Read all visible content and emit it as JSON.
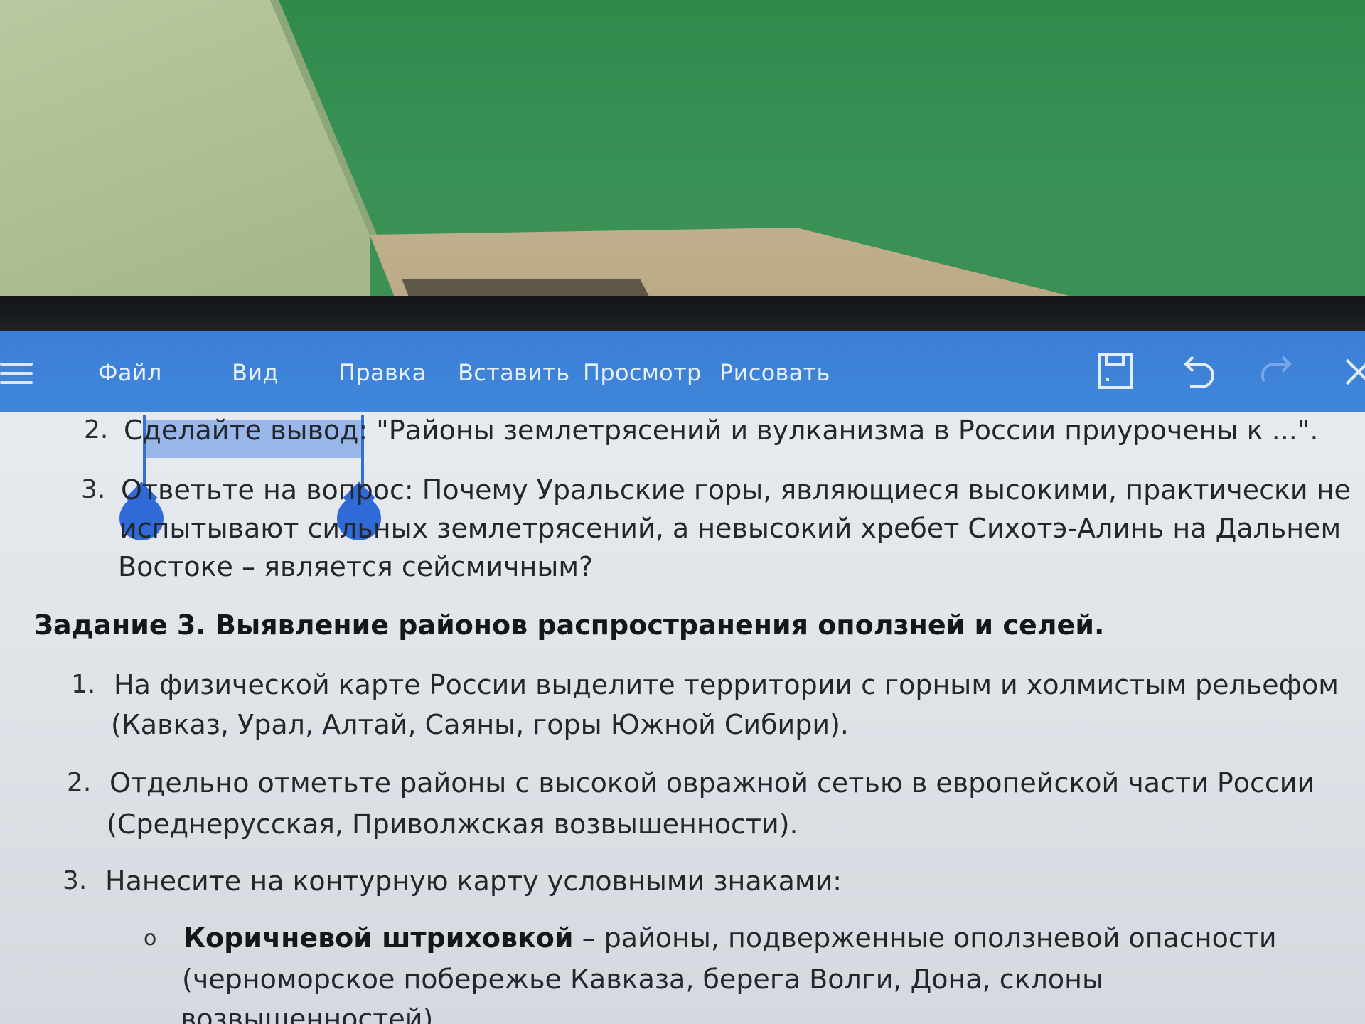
{
  "app": {
    "menu": [
      "Файл",
      "Вид",
      "Правка",
      "Вставить",
      "Просмотр",
      "Рисовать"
    ]
  },
  "toolbar_icons": [
    "menu-icon",
    "save-icon",
    "undo-icon",
    "redo-icon",
    "close-icon"
  ],
  "colors": {
    "toolbar": "#3b7fd6",
    "selection": "#5a8ce6",
    "selection_handle": "#2f6ad6",
    "page_text": "#23272c"
  },
  "document": {
    "task2_items": [
      {
        "number": "2.",
        "text_before_selection": "С",
        "selected_text": "делайте вывод: \"",
        "text_after_selection": "Районы землетрясений и вулканизма в России приурочены к ...\"."
      },
      {
        "number": "3.",
        "line1": "Ответьте на вопрос: Почему Уральские горы, являющиеся высокими, практически не",
        "line2": "испытывают сильных землетрясений, а невысокий хребет Сихотэ-Алинь на Дальнем",
        "line3": "Востоке – является сейсмичным?"
      }
    ],
    "task3_heading": "Задание 3. Выявление районов распространения оползней и селей.",
    "task3_items": [
      {
        "number": "1.",
        "line1": "На физической карте России выделите территории с горным и холмистым рельефом",
        "line2": "(Кавказ, Урал, Алтай, Саяны, горы Южной Сибири)."
      },
      {
        "number": "2.",
        "line1": "Отдельно отметьте районы с высокой овражной сетью в европейской части России",
        "line2": "(Среднерусская, Приволжская возвышенности)."
      },
      {
        "number": "3.",
        "line1": "Нанесите на контурную карту условными знаками:"
      }
    ],
    "bullet": {
      "marker": "o",
      "bold": "Коричневой штриховкой",
      "rest": " – районы, подверженные оползневой опасности",
      "line2": "(черноморское побережье Кавказа, берега Волги, Дона, склоны",
      "line3": "возвышенностей)."
    }
  }
}
